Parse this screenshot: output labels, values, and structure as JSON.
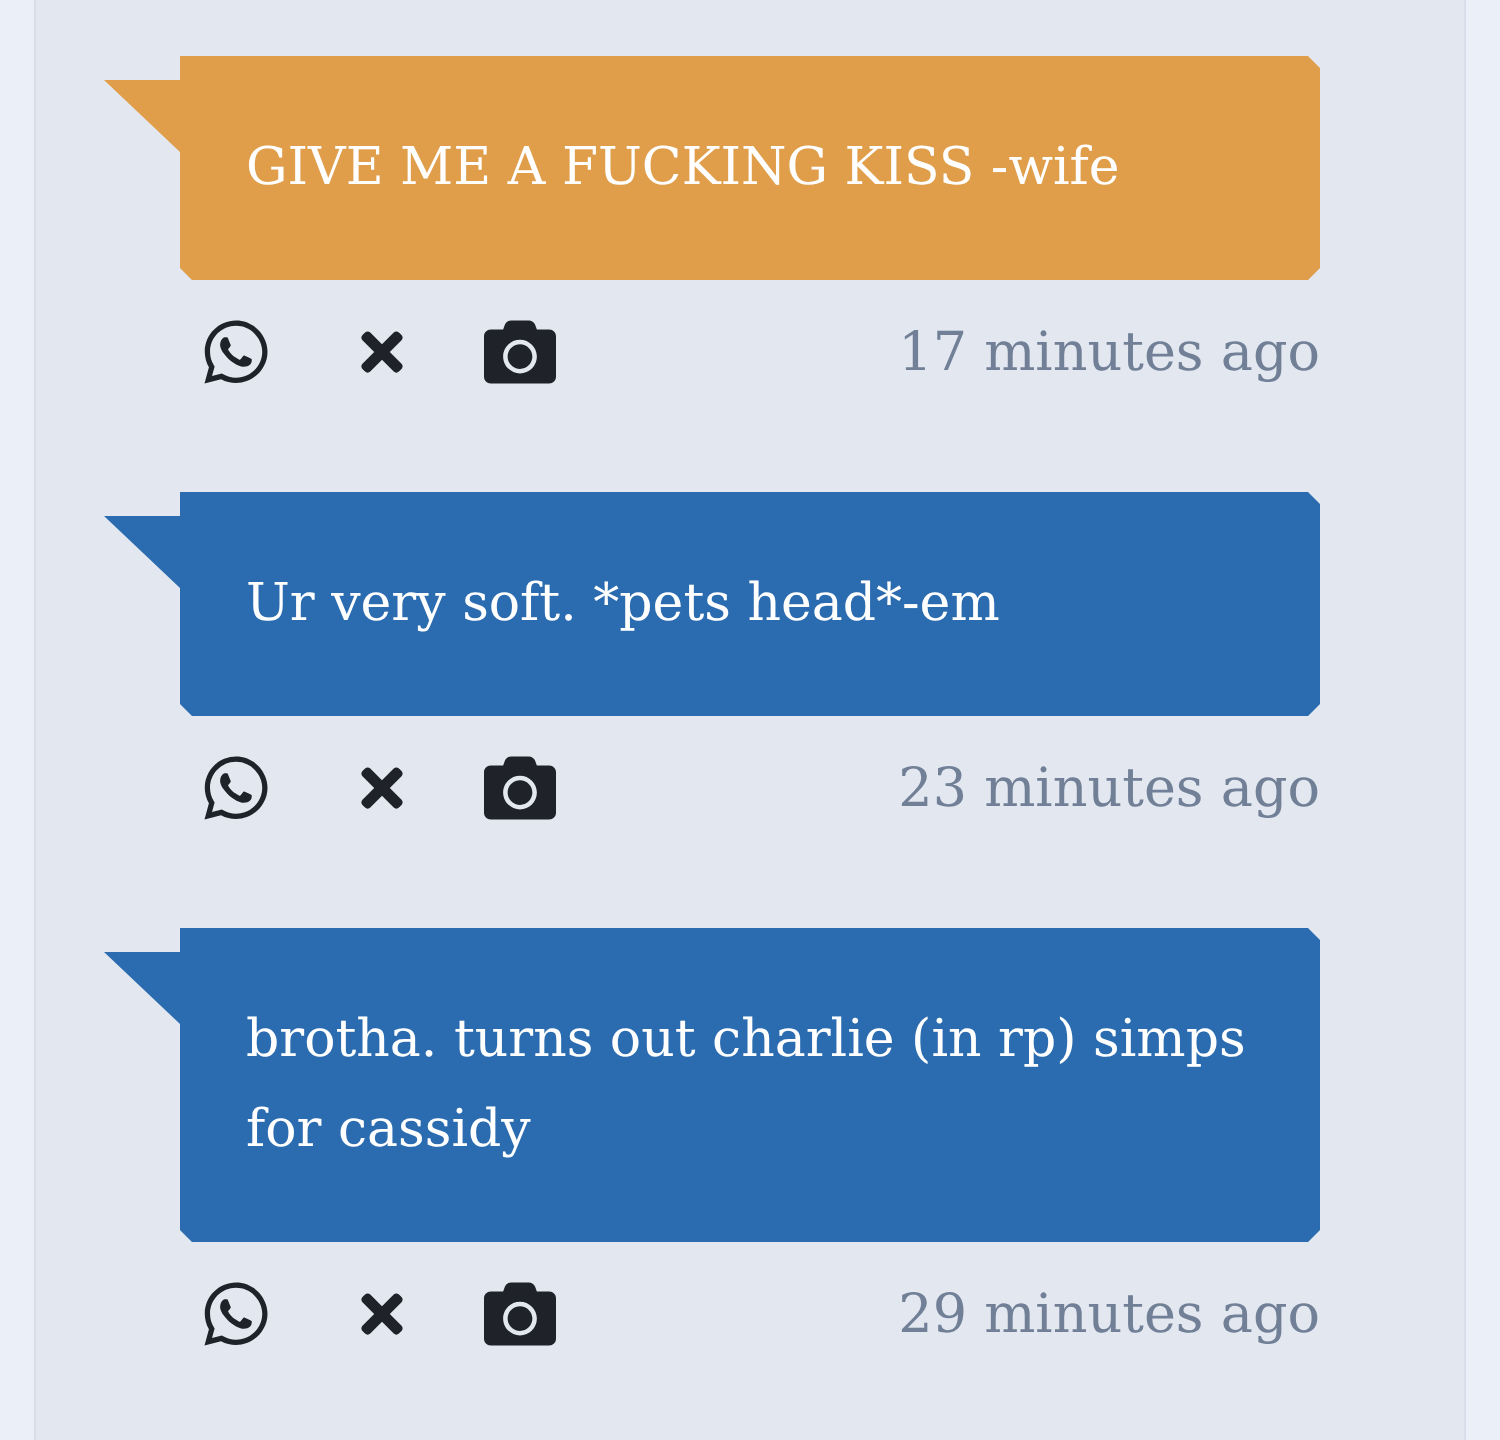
{
  "messages": [
    {
      "text": "GIVE ME A FUCKING KISS -wife",
      "color": "#e09e4b",
      "time": "17 minutes ago"
    },
    {
      "text": "Ur very soft. *pets head*-em",
      "color": "#2b6cb0",
      "time": "23 minutes ago"
    },
    {
      "text": "brotha. turns out charlie (in rp) simps for cassidy",
      "color": "#2b6cb0",
      "time": "29 minutes ago"
    }
  ]
}
